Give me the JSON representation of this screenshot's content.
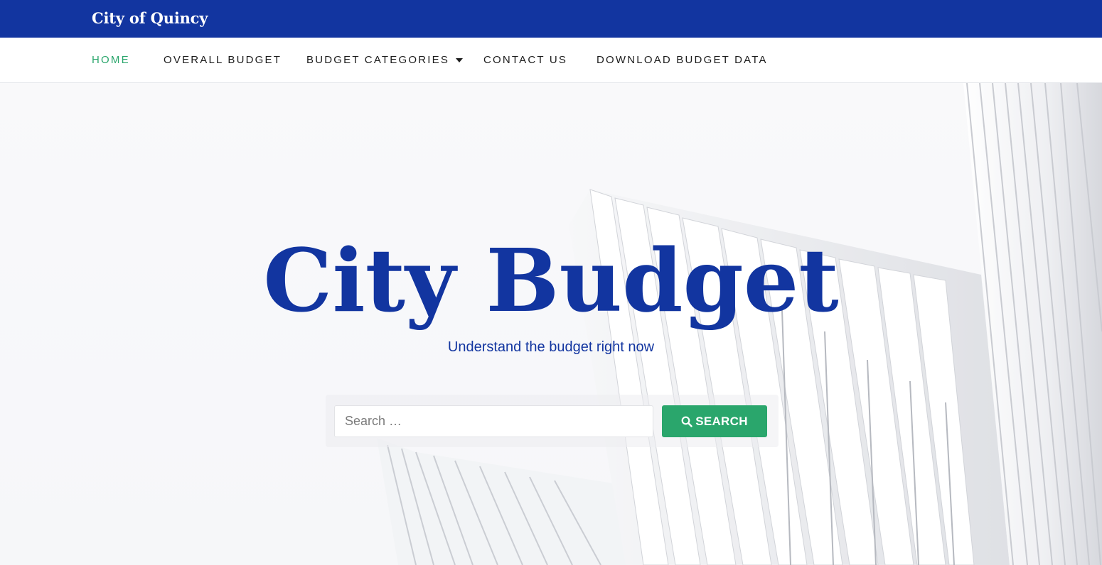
{
  "header": {
    "site_title": "City of Quincy",
    "brand_color": "#1235a0"
  },
  "nav": {
    "items": [
      {
        "label": "HOME",
        "active": true
      },
      {
        "label": "OVERALL BUDGET",
        "active": false
      },
      {
        "label": "BUDGET CATEGORIES",
        "active": false,
        "has_dropdown": true,
        "icon": "caret-down-icon"
      },
      {
        "label": "CONTACT US",
        "active": false
      },
      {
        "label": "DOWNLOAD BUDGET DATA",
        "active": false
      }
    ],
    "active_color": "#2aa66c"
  },
  "hero": {
    "title": "City Budget",
    "subtitle": "Understand the budget right now",
    "background": "white architectural structure photo"
  },
  "search": {
    "placeholder": "Search …",
    "value": "",
    "button_label": "SEARCH",
    "button_icon": "search-icon",
    "button_color": "#2aa66c"
  }
}
